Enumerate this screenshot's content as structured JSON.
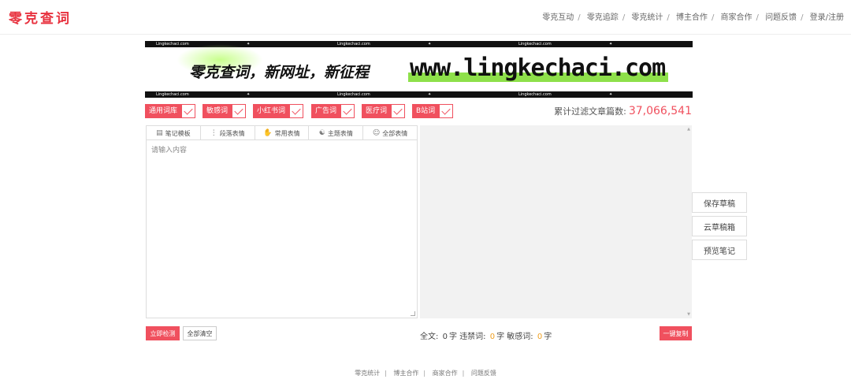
{
  "header": {
    "logo": "零克查词",
    "nav": [
      "零克互动",
      "零克追踪",
      "零克统计",
      "博主合作",
      "商家合作",
      "问题反馈",
      "登录/注册"
    ]
  },
  "banner": {
    "stripe_text": "Lingkechaci.com",
    "slogan": "零克查词，新网址，新征程",
    "url": "www.lingkechaci.com"
  },
  "filters": [
    {
      "label": "通用词库",
      "checked": true
    },
    {
      "label": "敏感词",
      "checked": true
    },
    {
      "label": "小红书词",
      "checked": true
    },
    {
      "label": "广告词",
      "checked": true
    },
    {
      "label": "医疗词",
      "checked": true
    },
    {
      "label": "B站词",
      "checked": true
    }
  ],
  "counter": {
    "label": "累计过滤文章篇数:",
    "value": "37,066,541"
  },
  "editor": {
    "toolbar": [
      {
        "icon": "notebook-icon",
        "glyph": "▤",
        "label": "笔记模板"
      },
      {
        "icon": "more-vertical-icon",
        "glyph": "⋮",
        "label": "段落表情"
      },
      {
        "icon": "hand-icon",
        "glyph": "✋",
        "label": "常用表情"
      },
      {
        "icon": "palette-icon",
        "glyph": "☯",
        "label": "主题表情"
      },
      {
        "icon": "smiley-icon",
        "glyph": "☺",
        "label": "全部表情"
      }
    ],
    "placeholder": "请输入内容",
    "value": ""
  },
  "side_buttons": {
    "save_draft": "保存草稿",
    "cloud_drafts": "云草稿箱",
    "preview_note": "预览笔记"
  },
  "actions": {
    "check_now": "立即检测",
    "clear_all": "全部清空",
    "copy_all": "一键复制"
  },
  "stats": {
    "full_text_label": "全文:",
    "full_text_value": "0",
    "char_unit": "字",
    "banned_label": "违禁词:",
    "banned_value": "0",
    "sensitive_label": "敏感词:",
    "sensitive_value": "0"
  },
  "footer": {
    "links": [
      "零克统计",
      "博主合作",
      "商家合作",
      "问题反馈"
    ]
  },
  "colors": {
    "brand": "#e8323f",
    "accent": "#f0505e",
    "banner_green": "#8ee04a",
    "warn": "#f0a020"
  }
}
